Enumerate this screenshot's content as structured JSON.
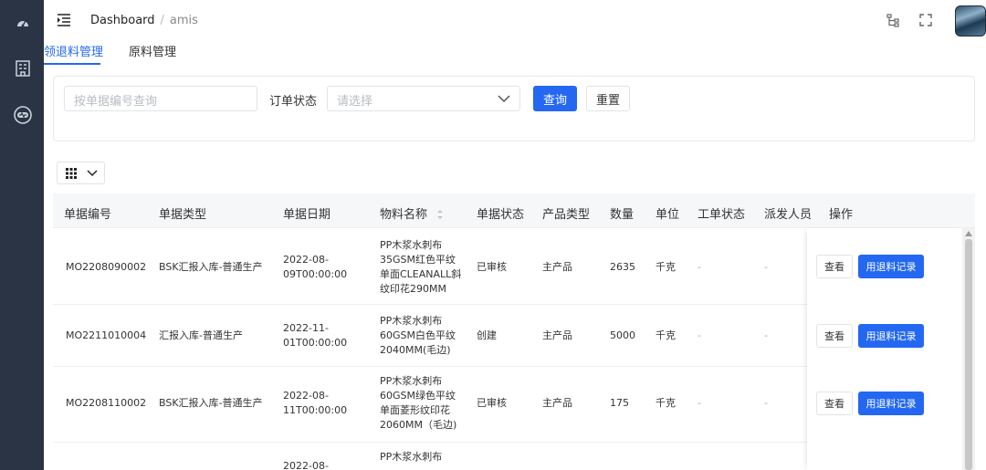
{
  "header": {
    "breadcrumb": {
      "root": "Dashboard",
      "current": "amis"
    }
  },
  "tabs": [
    {
      "label": "领退料管理",
      "active": true
    },
    {
      "label": "原料管理",
      "active": false
    }
  ],
  "filter": {
    "search_placeholder": "按单据编号查询",
    "status_label": "订单状态",
    "status_placeholder": "请选择",
    "query_label": "查询",
    "reset_label": "重置"
  },
  "table": {
    "columns": [
      "单据编号",
      "单据类型",
      "单据日期",
      "物料名称",
      "单据状态",
      "产品类型",
      "数量",
      "单位",
      "工单状态",
      "派发人员",
      "操作"
    ],
    "rows": [
      {
        "code": "MO2208090002",
        "type": "BSK汇报入库-普通生产",
        "date_l1": "2022-08-",
        "date_l2": "09T00:00:00",
        "material": [
          "PP木浆水刺布",
          "35GSM红色平纹",
          "单面CLEANALL斜",
          "纹印花290MM"
        ],
        "status": "已审核",
        "product": "主产品",
        "qty": "2635",
        "unit": "千克",
        "work_status": "-",
        "dispatcher": "-"
      },
      {
        "code": "MO2211010004",
        "type": "汇报入库-普通生产",
        "date_l1": "2022-11-",
        "date_l2": "01T00:00:00",
        "material": [
          "PP木浆水刺布",
          "60GSM白色平纹",
          "2040MM(毛边)"
        ],
        "status": "创建",
        "product": "主产品",
        "qty": "5000",
        "unit": "千克",
        "work_status": "-",
        "dispatcher": "-"
      },
      {
        "code": "MO2208110002",
        "type": "BSK汇报入库-普通生产",
        "date_l1": "2022-08-",
        "date_l2": "11T00:00:00",
        "material": [
          "PP木浆水刺布",
          "60GSM绿色平纹",
          "单面菱形纹印花",
          "2060MM（毛边)"
        ],
        "status": "已审核",
        "product": "主产品",
        "qty": "175",
        "unit": "千克",
        "work_status": "-",
        "dispatcher": "-"
      },
      {
        "date_l1": "2022-08-",
        "material": [
          "PP木浆水刺布"
        ]
      }
    ],
    "actions": {
      "view_label": "查看",
      "record_label": "用退料记录"
    }
  },
  "colors": {
    "sidebar": "#2a3444",
    "primary": "#2468f2"
  }
}
